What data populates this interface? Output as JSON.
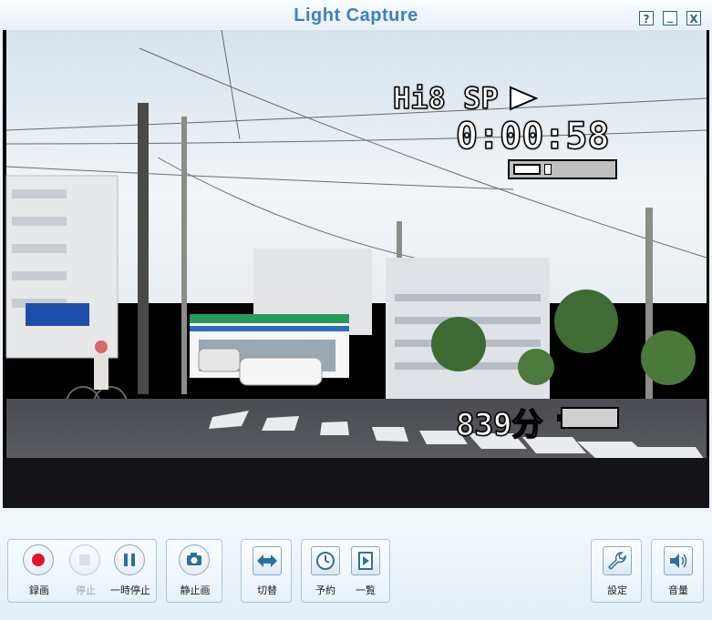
{
  "window": {
    "title": "Light Capture",
    "help_label": "?",
    "minimize_label": "_",
    "close_label": "X"
  },
  "osd": {
    "format_text": "Hi8 SP",
    "timecode": "0:00:58",
    "remaining_text": "839分",
    "tape_progress": 0.1,
    "battery_level": 0.0
  },
  "controls": {
    "record": {
      "label": "録画",
      "enabled": true
    },
    "stop": {
      "label": "停止",
      "enabled": false
    },
    "pause": {
      "label": "一時停止",
      "enabled": true
    },
    "snapshot": {
      "label": "静止画",
      "enabled": true
    },
    "switch": {
      "label": "切替",
      "enabled": true
    },
    "schedule": {
      "label": "予約",
      "enabled": true
    },
    "list": {
      "label": "一覧",
      "enabled": true
    },
    "settings": {
      "label": "設定",
      "enabled": true
    },
    "volume": {
      "label": "音量",
      "enabled": true
    }
  },
  "colors": {
    "accent": "#3b7fc4",
    "record_red": "#e8102a",
    "icon_blue": "#2f6f9f"
  }
}
